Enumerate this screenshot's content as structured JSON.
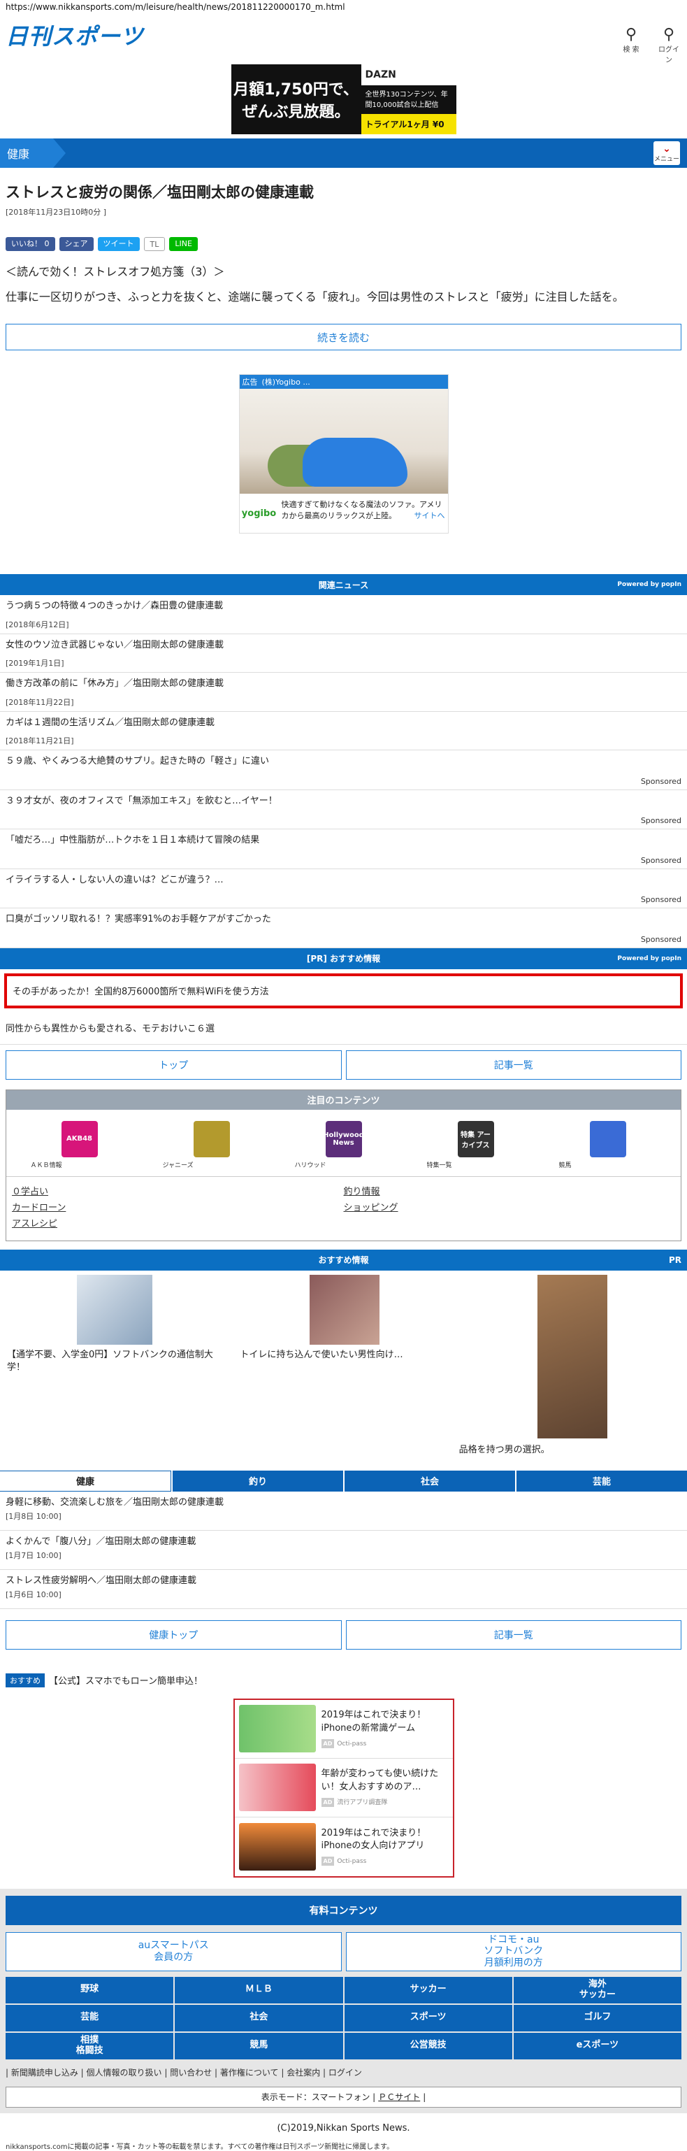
{
  "url": "https://www.nikkansports.com/m/leisure/health/news/201811220000170_m.html",
  "header": {
    "logo": "日刊スポーツ",
    "search_label": "検 索",
    "login_label": "ログイン"
  },
  "top_ad": {
    "line1": "月額1,750円で、",
    "line2": "ぜんぶ見放題。",
    "brand": "DAZN",
    "copy": "全世界130コンテンツ、年間10,000試合以上配信",
    "cta": "トライアル1ヶ月 ¥0"
  },
  "section": {
    "label": "健康",
    "menu_label": "メニュー"
  },
  "article": {
    "title": "ストレスと疲労の関係／塩田剛太郎の健康連載",
    "date": "[2018年11月23日10時0分 ]",
    "share": {
      "like": "いいね！ 0",
      "share": "シェア",
      "tweet": "ツイート",
      "tl": "TL",
      "line": "LINE"
    },
    "subhead": "＜読んで効く！ストレスオフ処方箋（3）＞",
    "lead": "仕事に一区切りがつき、ふっと力を抜くと、途端に襲ってくる「疲れ」。今回は男性のストレスと「疲労」に注目した話を。",
    "read_more": "続きを読む"
  },
  "mid_ad": {
    "tag": "広告",
    "sponsor": "(株)Yogibo ...",
    "brand": "yogibo",
    "text": "快適すぎて動けなくなる魔法のソファ。アメリカから最高のリラックスが上陸。",
    "site": "サイトへ"
  },
  "related": {
    "heading": "関連ニュース",
    "powered": "Powered by popIn",
    "items": [
      {
        "title": "うつ病５つの特徴４つのきっかけ／森田豊の健康連載",
        "date": "[2018年6月12日]"
      },
      {
        "title": "女性のウソ泣き武器じゃない／塩田剛太郎の健康連載",
        "date": "[2019年1月1日]"
      },
      {
        "title": "働き方改革の前に「休み方」／塩田剛太郎の健康連載",
        "date": "[2018年11月22日]"
      },
      {
        "title": "カギは１週間の生活リズム／塩田剛太郎の健康連載",
        "date": "[2018年11月21日]"
      }
    ],
    "sponsored": [
      "５９歳、やくみつる大絶賛のサプリ。起きた時の「軽さ」に違い",
      "３９才女が、夜のオフィスで「無添加エキス」を飲むと…イヤー！",
      "「嘘だろ…」中性脂肪が…トクホを１日１本続けて冒険の結果",
      "イライラする人・しない人の違いは？どこが違う？…",
      "口臭がゴッソリ取れる！？実感率91%のお手軽ケアがすごかった"
    ],
    "sponsored_label": "Sponsored"
  },
  "pr": {
    "heading": "[PR] おすすめ情報",
    "powered": "Powered by popIn",
    "highlighted": "その手があったか！全国約8万6000箇所で無料WiFiを使う方法",
    "second": "同性からも異性からも愛される、モテおけいこ６選"
  },
  "nav_buttons": {
    "top": "トップ",
    "articles": "記事一覧"
  },
  "chumoku": {
    "heading": "注目のコンテンツ",
    "icons": [
      {
        "label": "ＡＫＢ情報",
        "color": "#d7157a"
      },
      {
        "label": "ジャニーズ",
        "color": "#b39a2d"
      },
      {
        "label": "ハリウッド",
        "color": "#5c2e7a"
      },
      {
        "label": "特集一覧",
        "color": "#333333"
      },
      {
        "label": "競馬",
        "color": "#3a6bd6"
      }
    ],
    "icon_texts": {
      "akb": "AKB48",
      "hollywood": "Hollywood News",
      "special": "特集 アーカイブス"
    },
    "links": [
      "０学占い",
      "釣り情報",
      "カードローン",
      "ショッピング",
      "アスレシピ"
    ]
  },
  "recommend": {
    "heading": "おすすめ情報",
    "pr": "PR",
    "items": [
      "【通学不要、入学金0円】ソフトバンクの通信制大学！",
      "トイレに持ち込んで使いたい男性向け…",
      "品格を持つ男の選択。"
    ]
  },
  "tabs": [
    "健康",
    "釣り",
    "社会",
    "芸能"
  ],
  "health_list": [
    {
      "title": "身軽に移動、交流楽しむ旅を／塩田剛太郎の健康連載",
      "date": "[1月8日 10:00]"
    },
    {
      "title": "よくかんで「腹八分」／塩田剛太郎の健康連載",
      "date": "[1月7日 10:00]"
    },
    {
      "title": "ストレス性疲労解明へ／塩田剛太郎の健康連載",
      "date": "[1月6日 10:00]"
    }
  ],
  "health_buttons": {
    "top": "健康トップ",
    "articles": "記事一覧"
  },
  "osusume": {
    "tag": "おすすめ",
    "text": "【公式】スマホでもローン簡単申込！"
  },
  "apps": [
    {
      "title": "2019年はこれで決まり！iPhoneの新常識ゲーム",
      "src": "Octi-pass"
    },
    {
      "title": "年齢が変わっても使い続けたい！女人おすすめのア…",
      "src": "流行アプリ調査隊"
    },
    {
      "title": "2019年はこれで決まり！iPhoneの女人向けアプリ",
      "src": "Octi-pass"
    }
  ],
  "paid": {
    "heading": "有料コンテンツ",
    "au": "auスマートパス\n会員の方",
    "docomo": "ドコモ・au\nソフトバンク\n月額利用の方"
  },
  "categories": [
    "野球",
    "ＭＬＢ",
    "サッカー",
    "海外\nサッカー",
    "芸能",
    "社会",
    "スポーツ",
    "ゴルフ",
    "相撲\n格闘技",
    "競馬",
    "公営競技",
    "eスポーツ"
  ],
  "footer": {
    "links": "| 新聞購読申し込み | 個人情報の取り扱い | 問い合わせ | 著作権について | 会社案内 | ログイン",
    "display_mode": "表示モード：スマートフォン |",
    "pc_site": "ＰＣサイト",
    "display_end": "|",
    "copyright": "(C)2019,Nikkan Sports News.",
    "disclaimer": "nikkansports.comに掲載の記事・写真・カット等の転載を禁じます。すべての著作権は日刊スポーツ新聞社に帰属します。"
  }
}
